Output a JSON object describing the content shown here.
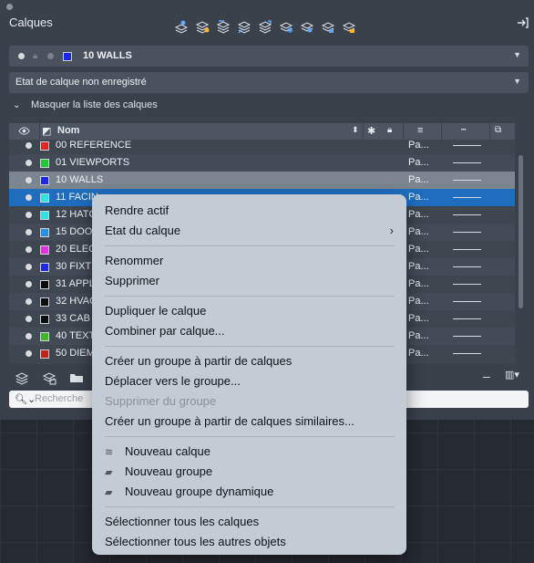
{
  "palette": {
    "title": "Calques",
    "current_layer": "10 WALLS",
    "current_layer_color": "#1c28e6",
    "layer_state": "Etat de calque non enregistré",
    "hide_list_label": "Masquer la liste des calques",
    "search_placeholder": "Recherche"
  },
  "table": {
    "name_header": "Nom",
    "rows": [
      {
        "name": "00 REFERENCE",
        "color": "#e0261f",
        "plot": "Pa..."
      },
      {
        "name": "01 VIEWPORTS",
        "color": "#20c63a",
        "plot": "Pa..."
      },
      {
        "name": "10 WALLS",
        "color": "#1c28e6",
        "plot": "Pa..."
      },
      {
        "name": "11 FACIN",
        "color": "#2fe3e3",
        "plot": "Pa..."
      },
      {
        "name": "12 HATC",
        "color": "#2fe3e3",
        "plot": "Pa..."
      },
      {
        "name": "15 DOO",
        "color": "#2a8fe3",
        "plot": "Pa..."
      },
      {
        "name": "20 ELEC",
        "color": "#e330e0",
        "plot": "Pa..."
      },
      {
        "name": "30 FIXT",
        "color": "#1c28e6",
        "plot": "Pa..."
      },
      {
        "name": "31 APPL",
        "color": "#0c0c0c",
        "plot": "Pa..."
      },
      {
        "name": "32 HVAC",
        "color": "#0c0c0c",
        "plot": "Pa..."
      },
      {
        "name": "33 CAB",
        "color": "#0c0c0c",
        "plot": "Pa..."
      },
      {
        "name": "40 TEXT",
        "color": "#3fb52b",
        "plot": "Pa..."
      },
      {
        "name": "50 DIEM",
        "color": "#c2231c",
        "plot": "Pa..."
      }
    ]
  },
  "menu": {
    "items": [
      "Rendre actif",
      "Etat du calque",
      "Renommer",
      "Supprimer",
      "Dupliquer le calque",
      "Combiner par calque...",
      "Créer un groupe à partir de calques",
      "Déplacer vers le groupe...",
      "Supprimer du groupe",
      "Créer un groupe à partir de calques similaires...",
      "Nouveau calque",
      "Nouveau groupe",
      "Nouveau groupe dynamique",
      "Sélectionner tous les calques",
      "Sélectionner tous les autres objets"
    ]
  }
}
